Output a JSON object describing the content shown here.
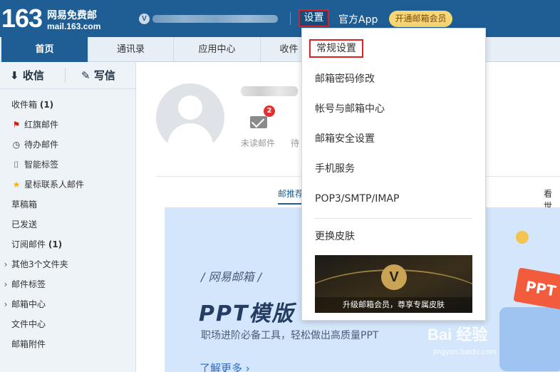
{
  "header": {
    "logo_number": "163",
    "logo_name": "网易免费邮",
    "logo_domain": "mail.163.com",
    "vip_letter": "V",
    "settings_label": "设置",
    "official_app": "官方App",
    "vip_button": "开通邮箱会员"
  },
  "tabs": [
    {
      "label": "首页",
      "active": true
    },
    {
      "label": "通讯录"
    },
    {
      "label": "应用中心"
    },
    {
      "label": "收件"
    }
  ],
  "sidebar": {
    "receive": "收信",
    "write": "写信",
    "folders": [
      {
        "label": "收件箱",
        "count": "(1)",
        "icon": ""
      },
      {
        "label": "红旗邮件",
        "icon": "flag-icon"
      },
      {
        "label": "待办邮件",
        "icon": "clock-icon"
      },
      {
        "label": "智能标签",
        "icon": "bookmark-icon"
      },
      {
        "label": "星标联系人邮件",
        "icon": "star-icon"
      },
      {
        "label": "草稿箱"
      },
      {
        "label": "已发送"
      },
      {
        "label": "订阅邮件",
        "count": "(1)"
      },
      {
        "label": "其他3个文件夹",
        "expandable": true
      },
      {
        "label": "邮件标签",
        "expandable": true
      },
      {
        "label": "邮箱中心",
        "expandable": true
      },
      {
        "label": "文件中心"
      },
      {
        "label": "邮箱附件"
      }
    ]
  },
  "main": {
    "unread_badge": "2",
    "stat_unread": "未读邮件",
    "stat_todo": "待",
    "subtab_recommend": "邮推荐",
    "subtab_right": "看世",
    "banner": {
      "brand": "/ 网易邮箱 /",
      "title": "PPT模版",
      "subtitle": "职场进阶必备工具，轻松做出高质量PPT",
      "more": "了解更多 ›",
      "ppt_tag": "PPT"
    }
  },
  "dropdown": {
    "items": [
      "常规设置",
      "邮箱密码修改",
      "帐号与邮箱中心",
      "邮箱安全设置",
      "手机服务",
      "POP3/SMTP/IMAP",
      "更换皮肤"
    ],
    "skin_caption": "升级邮箱会员，尊享专属皮肤",
    "skin_letter": "V"
  },
  "watermark": {
    "text": "Bai 经验",
    "url": "jingyan.baidu.com"
  }
}
